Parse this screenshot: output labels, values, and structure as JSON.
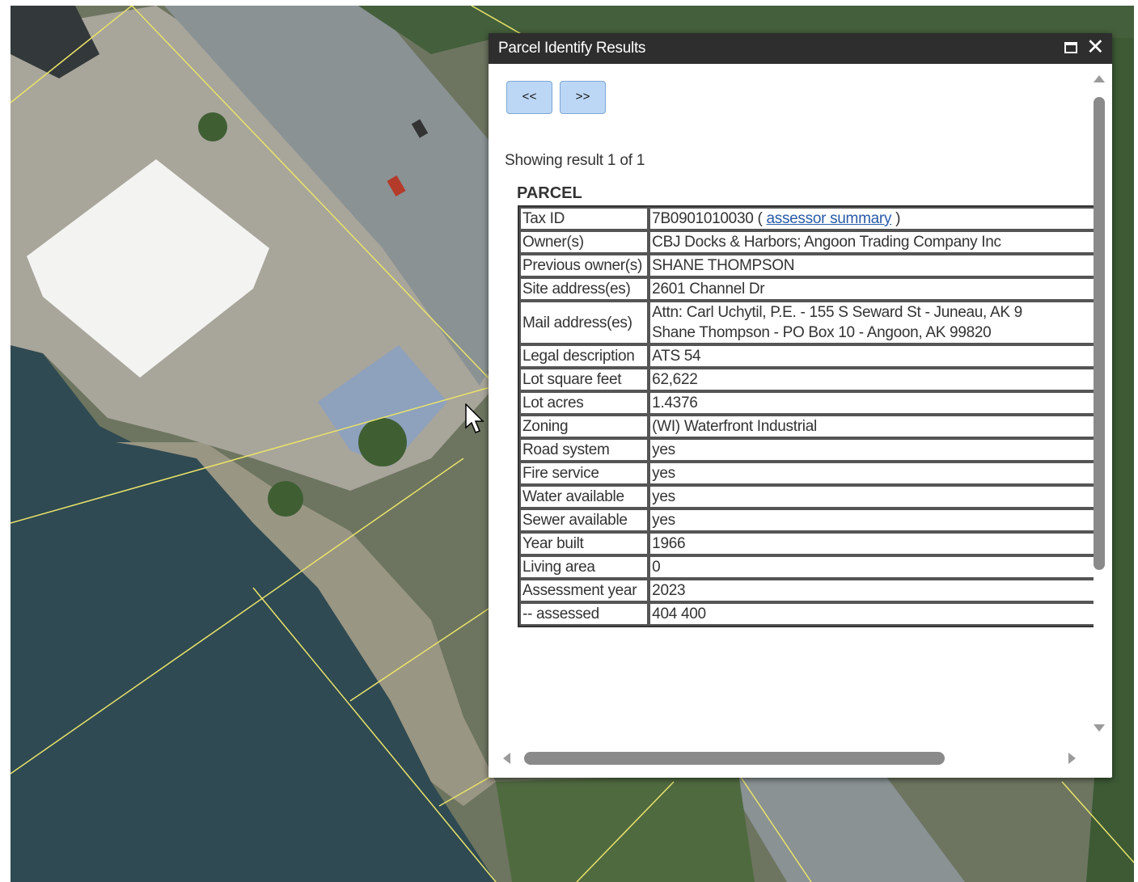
{
  "map": {
    "colors": {
      "water": "#2f4a52",
      "road": "#8a9294",
      "lot": "#a8a59b",
      "parcel_line": "#e9e36a",
      "vegetation": "#4a6a3a"
    }
  },
  "panel": {
    "title": "Parcel Identify Results",
    "maximize_icon": "maximize-icon",
    "close_icon": "close-icon",
    "prev_label": "<<",
    "next_label": ">>",
    "result_info": "Showing result 1 of 1",
    "section_heading": "PARCEL",
    "link_label": "assessor summary",
    "rows": [
      {
        "label": "Tax ID",
        "value": "7B0901010030 ("
      },
      {
        "label": "Owner(s)",
        "value": "CBJ Docks & Harbors; Angoon Trading Company Inc"
      },
      {
        "label": "Previous owner(s)",
        "value": "SHANE THOMPSON"
      },
      {
        "label": "Site address(es)",
        "value": "2601 Channel Dr"
      },
      {
        "label": "Mail address(es)",
        "value": "Attn: Carl Uchytil, P.E. - 155 S Seward St - Juneau, AK 9",
        "value2": "Shane Thompson - PO Box 10 - Angoon, AK 99820"
      },
      {
        "label": "Legal description",
        "value": "ATS 54"
      },
      {
        "label": "Lot square feet",
        "value": "62,622"
      },
      {
        "label": "Lot acres",
        "value": "1.4376"
      },
      {
        "label": "Zoning",
        "value": "(WI) Waterfront Industrial"
      },
      {
        "label": "Road system",
        "value": "yes"
      },
      {
        "label": "Fire service",
        "value": "yes"
      },
      {
        "label": "Water available",
        "value": "yes"
      },
      {
        "label": "Sewer available",
        "value": "yes"
      },
      {
        "label": "Year built",
        "value": "1966"
      },
      {
        "label": "Living area",
        "value": "0"
      },
      {
        "label": "Assessment year",
        "value": "2023"
      },
      {
        "label": "-- assessed",
        "value": "404 400"
      }
    ]
  }
}
